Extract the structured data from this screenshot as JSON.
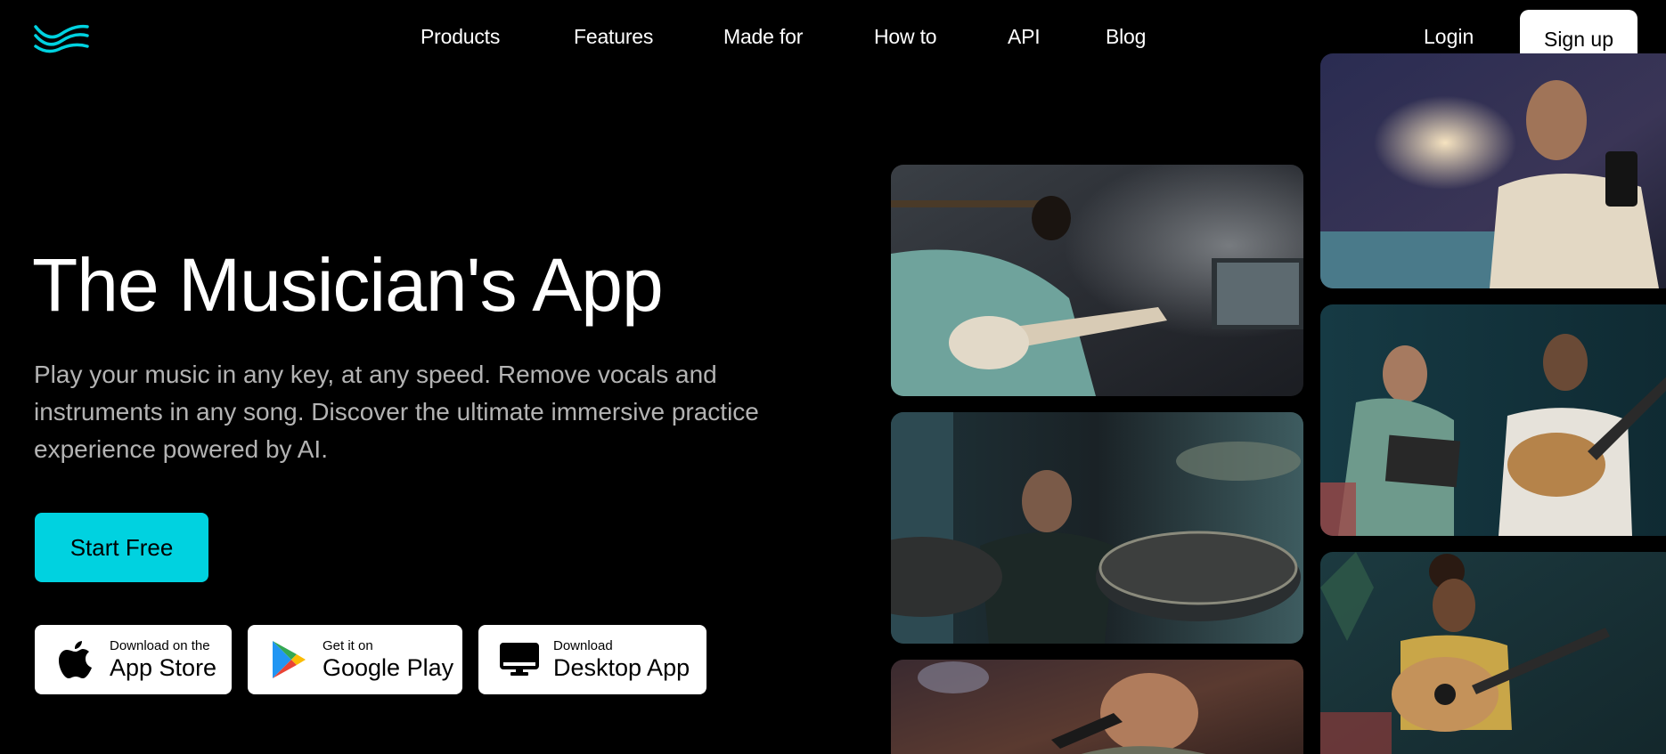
{
  "nav": {
    "logo_name": "wave-logo-icon",
    "items": [
      "Products",
      "Features",
      "Made for",
      "How to",
      "API",
      "Blog"
    ],
    "login": "Login",
    "signup": "Sign up"
  },
  "hero": {
    "title": "The Musician's App",
    "subtitle": "Play your music in any key, at any speed. Remove vocals and instruments in any song. Discover the ultimate immersive practice experience powered by AI.",
    "cta": "Start Free"
  },
  "downloads": [
    {
      "small": "Download on the",
      "big": "App Store",
      "icon": "apple-icon"
    },
    {
      "small": "Get it on",
      "big": "Google Play",
      "icon": "google-play-icon"
    },
    {
      "small": "Download",
      "big": "Desktop App",
      "icon": "desktop-monitor-icon"
    }
  ],
  "colors": {
    "accent": "#00d2e0",
    "background": "#000000",
    "subtitle": "#b3b3b3"
  },
  "gallery": [
    "musician-bass-headphones-photo",
    "musician-drummer-photo",
    "musician-older-man-photo",
    "musician-woman-phone-photo",
    "musicians-duo-guitar-tablet-photo",
    "musician-woman-acoustic-guitar-photo"
  ]
}
